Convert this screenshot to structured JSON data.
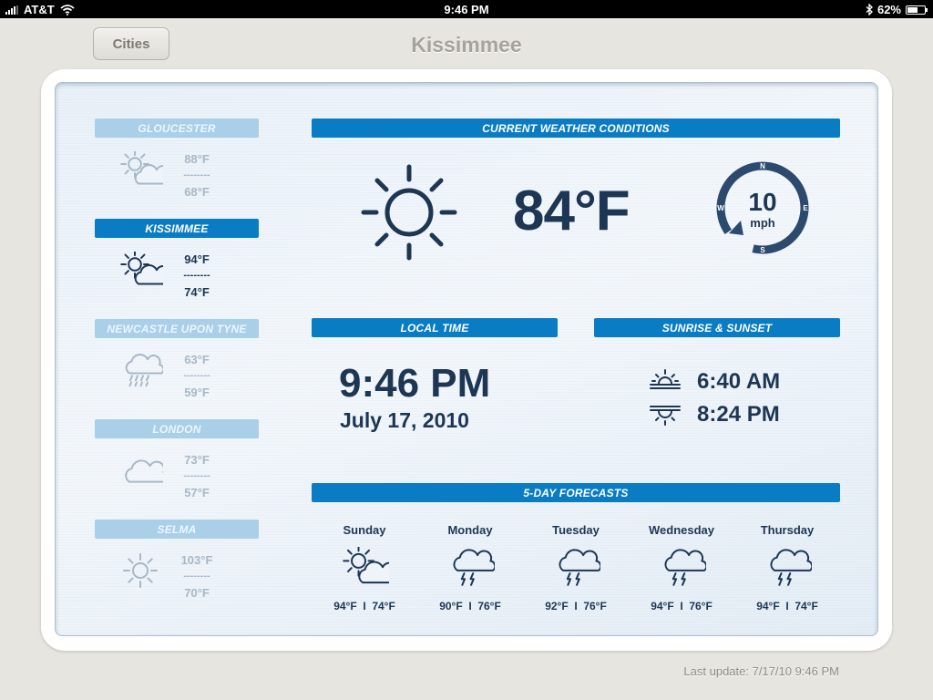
{
  "status_bar": {
    "carrier": "AT&T",
    "time": "9:46 PM",
    "battery": "62%",
    "battery_level": 0.62
  },
  "header": {
    "cities_button": "Cities",
    "title": "Kissimmee"
  },
  "cities": [
    {
      "name": "GLOUCESTER",
      "high": "88°F",
      "low": "68°F",
      "dash": "--------",
      "icon": "partly-cloudy-icon",
      "active": false
    },
    {
      "name": "KISSIMMEE",
      "high": "94°F",
      "low": "74°F",
      "dash": "--------",
      "icon": "partly-cloudy-icon",
      "active": true
    },
    {
      "name": "NEWCASTLE UPON TYNE",
      "high": "63°F",
      "low": "59°F",
      "dash": "--------",
      "icon": "rain-cloud-icon",
      "active": false
    },
    {
      "name": "LONDON",
      "high": "73°F",
      "low": "57°F",
      "dash": "--------",
      "icon": "cloud-icon",
      "active": false
    },
    {
      "name": "SELMA",
      "high": "103°F",
      "low": "70°F",
      "dash": "--------",
      "icon": "sun-icon",
      "active": false
    }
  ],
  "current": {
    "heading": "CURRENT WEATHER CONDITIONS",
    "temperature": "84°F",
    "condition_icon": "sun-icon",
    "wind": {
      "speed": "10",
      "unit": "mph",
      "n": "N",
      "e": "E",
      "s": "S",
      "w": "W"
    }
  },
  "local_time": {
    "heading": "LOCAL TIME",
    "time": "9:46 PM",
    "date": "July 17, 2010"
  },
  "sun": {
    "heading": "SUNRISE & SUNSET",
    "sunrise": "6:40 AM",
    "sunset": "8:24 PM"
  },
  "forecast": {
    "heading": "5-DAY FORECASTS",
    "days": [
      {
        "day": "Sunday",
        "temps": "94°F  I  74°F",
        "icon": "partly-cloudy-icon"
      },
      {
        "day": "Monday",
        "temps": "90°F  I  76°F",
        "icon": "thunderstorm-icon"
      },
      {
        "day": "Tuesday",
        "temps": "92°F  I  76°F",
        "icon": "thunderstorm-icon"
      },
      {
        "day": "Wednesday",
        "temps": "94°F  I  76°F",
        "icon": "thunderstorm-icon"
      },
      {
        "day": "Thursday",
        "temps": "94°F  I  74°F",
        "icon": "thunderstorm-icon"
      }
    ]
  },
  "footer": {
    "last_update": "Last update: 7/17/10 9:46 PM"
  },
  "colors": {
    "accent": "#0a7cc4",
    "text_dark": "#1d3654",
    "faded": "#a8b8c6"
  }
}
